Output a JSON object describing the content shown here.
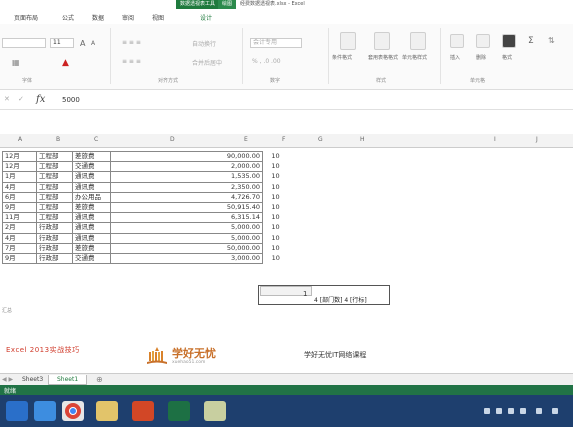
{
  "title": {
    "tool_tab": "数据透视表工具",
    "draw_tab": "绘图",
    "doc": "经费数据透视表.xlsx - Excel"
  },
  "tabs": [
    "页面布局",
    "公式",
    "数据",
    "审阅",
    "视图",
    "设计"
  ],
  "ribbon": {
    "font_size": "11",
    "increase_font": "A",
    "decrease_font": "A",
    "wrap_text": "自动换行",
    "merge_center": "合并后居中",
    "number_format": "会计专用",
    "conditional_format": "条件格式",
    "table_format": "套用表格格式",
    "cell_style": "单元格样式",
    "insert": "插入",
    "delete": "删除",
    "format": "格式",
    "group_font": "字体",
    "group_align": "对齐方式",
    "group_number": "数字",
    "group_style": "样式",
    "group_cells": "单元格"
  },
  "formula_bar": {
    "fx": "fx",
    "value": "5000"
  },
  "columns": [
    "A",
    "B",
    "C",
    "D",
    "E",
    "F",
    "G",
    "H",
    "I",
    "J"
  ],
  "rows": [
    {
      "month": "12月",
      "dept": "工程部",
      "type": "差旅费",
      "amount": "90,000.00",
      "n": "10"
    },
    {
      "month": "12月",
      "dept": "工程部",
      "type": "交通费",
      "amount": "2,000.00",
      "n": "10"
    },
    {
      "month": "1月",
      "dept": "工程部",
      "type": "通讯费",
      "amount": "1,535.00",
      "n": "10"
    },
    {
      "month": "4月",
      "dept": "工程部",
      "type": "通讯费",
      "amount": "2,350.00",
      "n": "10"
    },
    {
      "month": "6月",
      "dept": "工程部",
      "type": "办公用品",
      "amount": "4,726.70",
      "n": "10"
    },
    {
      "month": "9月",
      "dept": "工程部",
      "type": "差旅费",
      "amount": "50,915.40",
      "n": "10"
    },
    {
      "month": "11月",
      "dept": "工程部",
      "type": "通讯费",
      "amount": "6,315.14",
      "n": "10"
    },
    {
      "month": "2月",
      "dept": "行政部",
      "type": "通讯费",
      "amount": "5,000.00",
      "n": "10"
    },
    {
      "month": "4月",
      "dept": "行政部",
      "type": "通讯费",
      "amount": "5,000.00",
      "n": "10"
    },
    {
      "month": "7月",
      "dept": "行政部",
      "type": "差旅费",
      "amount": "50,000.00",
      "n": "10"
    },
    {
      "month": "9月",
      "dept": "行政部",
      "type": "交通费",
      "amount": "3,000.00",
      "n": "10"
    }
  ],
  "sheet": {
    "hint": "4 [部门数] 4 [行标]",
    "cursor": "1",
    "note": "汇总"
  },
  "banner": {
    "left": "Excel 2013实战技巧",
    "logo": "学好无忧",
    "logo_sub": "xuehao51.com",
    "right": "学好无忧IT网络课程"
  },
  "sheet_tabs": [
    "Sheet3",
    "Sheet1"
  ],
  "status": {
    "left": "就绪"
  },
  "colors": {
    "accent": "#217346",
    "taskbar": "#1e3f6e"
  },
  "taskbar_icons": [
    "ie-icon",
    "tencent-icon",
    "chrome-icon",
    "explorer-icon",
    "powerpoint-icon",
    "excel-icon",
    "image-viewer-icon"
  ]
}
